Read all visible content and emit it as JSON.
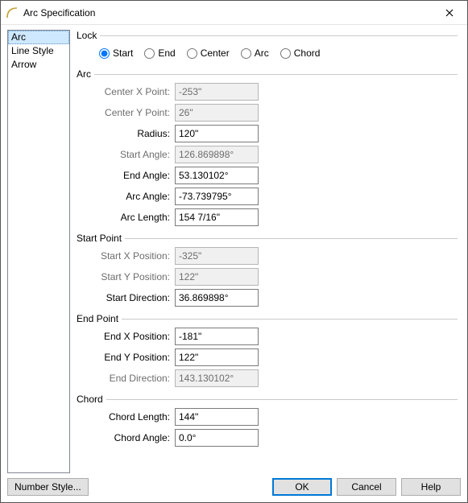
{
  "window": {
    "title": "Arc Specification"
  },
  "nav": {
    "items": [
      "Arc",
      "Line Style",
      "Arrow"
    ],
    "selected": 0
  },
  "groups": {
    "lock": {
      "legend": "Lock",
      "options": [
        "Start",
        "End",
        "Center",
        "Arc",
        "Chord"
      ],
      "selected": 0
    },
    "arc": {
      "legend": "Arc",
      "rows": [
        {
          "label": "Center X Point:",
          "value": "-253\"",
          "enabled": false
        },
        {
          "label": "Center Y Point:",
          "value": "26\"",
          "enabled": false
        },
        {
          "label": "Radius:",
          "value": "120\"",
          "enabled": true
        },
        {
          "label": "Start Angle:",
          "value": "126.869898°",
          "enabled": false
        },
        {
          "label": "End Angle:",
          "value": "53.130102°",
          "enabled": true
        },
        {
          "label": "Arc Angle:",
          "value": "-73.739795°",
          "enabled": true
        },
        {
          "label": "Arc Length:",
          "value": "154 7/16\"",
          "enabled": true
        }
      ]
    },
    "startPoint": {
      "legend": "Start Point",
      "rows": [
        {
          "label": "Start X Position:",
          "value": "-325\"",
          "enabled": false
        },
        {
          "label": "Start Y Position:",
          "value": "122\"",
          "enabled": false
        },
        {
          "label": "Start Direction:",
          "value": "36.869898°",
          "enabled": true
        }
      ]
    },
    "endPoint": {
      "legend": "End Point",
      "rows": [
        {
          "label": "End X Position:",
          "value": "-181\"",
          "enabled": true
        },
        {
          "label": "End Y Position:",
          "value": "122\"",
          "enabled": true
        },
        {
          "label": "End Direction:",
          "value": "143.130102°",
          "enabled": false
        }
      ]
    },
    "chord": {
      "legend": "Chord",
      "rows": [
        {
          "label": "Chord Length:",
          "value": "144\"",
          "enabled": true
        },
        {
          "label": "Chord Angle:",
          "value": "0.0°",
          "enabled": true
        }
      ]
    }
  },
  "footer": {
    "numberStyle": "Number Style...",
    "ok": "OK",
    "cancel": "Cancel",
    "help": "Help"
  }
}
